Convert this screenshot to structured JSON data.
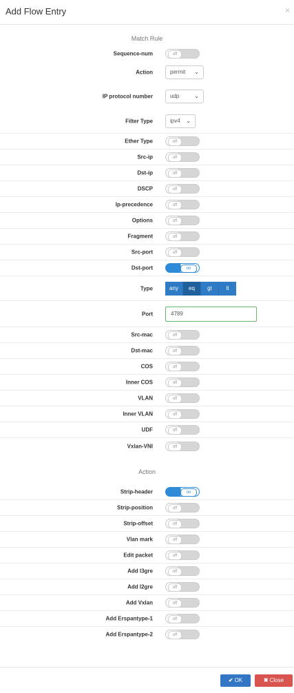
{
  "modal": {
    "title": "Add Flow Entry",
    "close_glyph": "×"
  },
  "match_section": {
    "title": "Match Rule"
  },
  "action_section": {
    "title": "Action"
  },
  "toggle_text": {
    "off": "off",
    "on": "on"
  },
  "match_rows": {
    "sequence_num": {
      "label": "Sequence-num",
      "state": "off"
    },
    "action": {
      "label": "Action",
      "value": "permit"
    },
    "ip_protocol_number": {
      "label": "IP protocol number",
      "value": "udp"
    },
    "filter_type": {
      "label": "Filter Type",
      "value": "ipv4"
    },
    "ether_type": {
      "label": "Ether Type",
      "state": "off"
    },
    "src_ip": {
      "label": "Src-ip",
      "state": "off"
    },
    "dst_ip": {
      "label": "Dst-ip",
      "state": "off"
    },
    "dscp": {
      "label": "DSCP",
      "state": "off"
    },
    "ip_precedence": {
      "label": "Ip-precedence",
      "state": "off"
    },
    "options": {
      "label": "Options",
      "state": "off"
    },
    "fragment": {
      "label": "Fragment",
      "state": "off"
    },
    "src_port": {
      "label": "Src-port",
      "state": "off"
    },
    "dst_port": {
      "label": "Dst-port",
      "state": "on"
    },
    "type": {
      "label": "Type",
      "options": [
        "any",
        "eq",
        "gt",
        "lt"
      ],
      "selected": "eq"
    },
    "port": {
      "label": "Port",
      "value": "4789"
    },
    "src_mac": {
      "label": "Src-mac",
      "state": "off"
    },
    "dst_mac": {
      "label": "Dst-mac",
      "state": "off"
    },
    "cos": {
      "label": "COS",
      "state": "off"
    },
    "inner_cos": {
      "label": "Inner COS",
      "state": "off"
    },
    "vlan": {
      "label": "VLAN",
      "state": "off"
    },
    "inner_vlan": {
      "label": "Inner VLAN",
      "state": "off"
    },
    "udf": {
      "label": "UDF",
      "state": "off"
    },
    "vxlan_vni": {
      "label": "Vxlan-VNI",
      "state": "off"
    }
  },
  "action_rows": {
    "strip_header": {
      "label": "Strip-header",
      "state": "on"
    },
    "strip_position": {
      "label": "Strip-position",
      "state": "off"
    },
    "strip_offset": {
      "label": "Strip-offset",
      "state": "off"
    },
    "vlan_mark": {
      "label": "Vlan mark",
      "state": "off"
    },
    "edit_packet": {
      "label": "Edit packet",
      "state": "off"
    },
    "add_l3gre": {
      "label": "Add l3gre",
      "state": "off"
    },
    "add_l2gre": {
      "label": "Add l2gre",
      "state": "off"
    },
    "add_vxlan": {
      "label": "Add Vxlan",
      "state": "off"
    },
    "add_erspantype_1": {
      "label": "Add Erspantype-1",
      "state": "off"
    },
    "add_erspantype_2": {
      "label": "Add Erspantype-2",
      "state": "off"
    }
  },
  "footer": {
    "ok_label": "OK",
    "close_label": "Close",
    "ok_icon": "✔",
    "close_icon": "✖"
  },
  "colors": {
    "primary": "#2f7bc6",
    "danger": "#d9534f",
    "toggle_on": "#2f8bd8",
    "input_border_valid": "#6cb36c"
  }
}
